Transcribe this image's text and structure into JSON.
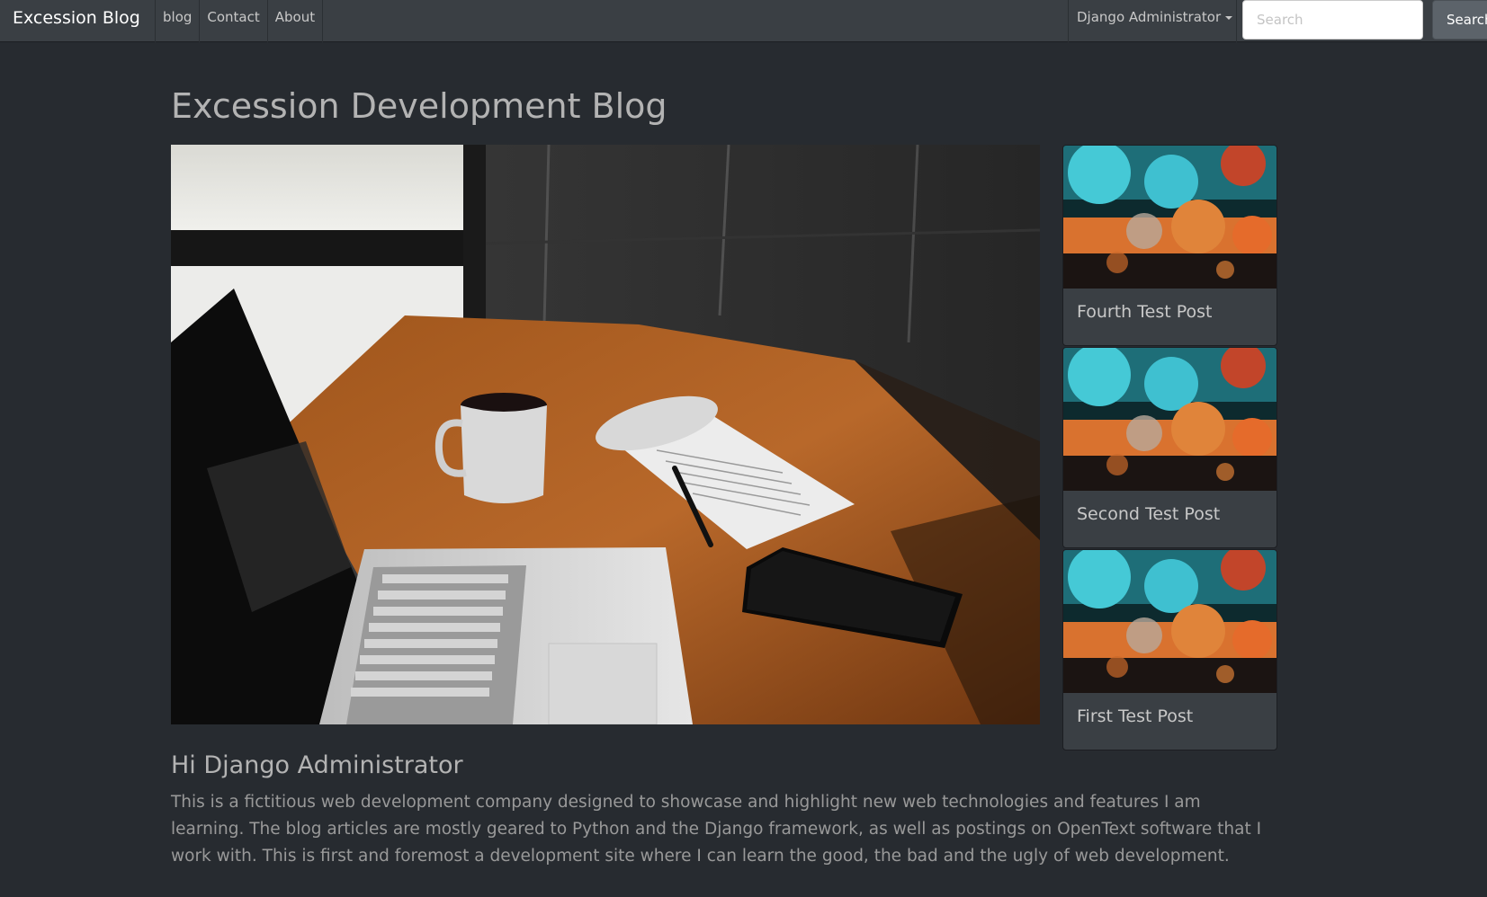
{
  "navbar": {
    "brand": "Excession Blog",
    "links": [
      "blog",
      "Contact",
      "About"
    ],
    "user_menu": "Django Administrator",
    "search_placeholder": "Search",
    "search_button": "Search"
  },
  "main": {
    "title": "Excession Development Blog",
    "greeting": "Hi Django Administrator",
    "intro": "This is a fictitious web development company designed to showcase and highlight new web technologies and features I am learning. The blog articles are mostly geared to Python and the Django framework, as well as postings on OpenText software that I work with. This is first and foremost a development site where I can learn the good, the bad and the ugly of web development."
  },
  "posts": [
    {
      "title": "Fourth Test Post"
    },
    {
      "title": "Second Test Post"
    },
    {
      "title": "First Test Post"
    }
  ],
  "colors": {
    "background": "#272b30",
    "navbar": "#3a3f44",
    "card": "#3a3f44"
  }
}
